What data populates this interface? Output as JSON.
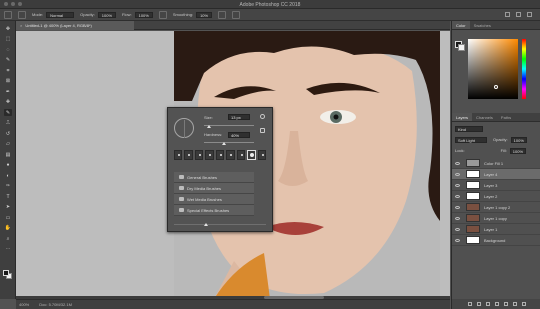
{
  "app": {
    "title": "Adobe Photoshop CC 2018"
  },
  "options_bar": {
    "mode_label": "Mode:",
    "mode_value": "Normal",
    "opacity_label": "Opacity:",
    "opacity_value": "100%",
    "flow_label": "Flow:",
    "flow_value": "100%",
    "smoothing_label": "Smoothing:",
    "smoothing_value": "10%"
  },
  "document": {
    "tab_label": "Untitled-1 @ 400% (Layer 4, RGB/8*)",
    "close_glyph": "×"
  },
  "status": {
    "zoom": "400%",
    "doc_size": "Doc: 5.70M/32.1M"
  },
  "brush_popup": {
    "size_label": "Size:",
    "size_value": "13 px",
    "hardness_label": "Hardness:",
    "hardness_value": "40%",
    "hardness_fraction": 0.4,
    "presets": [
      {
        "num": ""
      },
      {
        "num": ""
      },
      {
        "num": ""
      },
      {
        "num": ""
      },
      {
        "num": ""
      },
      {
        "num": ""
      },
      {
        "num": ""
      },
      {
        "num": ""
      },
      {
        "num": ""
      }
    ],
    "folders": [
      "General Brushes",
      "Dry Media Brushes",
      "Wet Media Brushes",
      "Special Effects Brushes"
    ]
  },
  "color_panel": {
    "tabs": [
      "Color",
      "Swatches"
    ]
  },
  "layers_panel": {
    "tabs": [
      "Layers",
      "Channels",
      "Paths"
    ],
    "kind_label": "Kind",
    "blend_mode": "Soft Light",
    "opacity_label": "Opacity:",
    "opacity_value": "100%",
    "lock_label": "Lock:",
    "fill_label": "Fill:",
    "fill_value": "100%",
    "layers": [
      {
        "name": "Color Fill 1",
        "thumb": "#9a9a9a",
        "selected": false
      },
      {
        "name": "Layer 4",
        "thumb": "#ffffff",
        "selected": true
      },
      {
        "name": "Layer 3",
        "thumb": "#ffffff",
        "selected": false
      },
      {
        "name": "Layer 2",
        "thumb": "#ffffff",
        "selected": false
      },
      {
        "name": "Layer 1 copy 2",
        "thumb": "#7a5040",
        "selected": false
      },
      {
        "name": "Layer 1 copy",
        "thumb": "#7a5040",
        "selected": false
      },
      {
        "name": "Layer 1",
        "thumb": "#7a5040",
        "selected": false
      },
      {
        "name": "Background",
        "thumb": "#ffffff",
        "selected": false
      }
    ]
  },
  "tools": [
    {
      "name": "move-tool-icon",
      "glyph": "✥"
    },
    {
      "name": "marquee-tool-icon",
      "glyph": "⬚"
    },
    {
      "name": "lasso-tool-icon",
      "glyph": "◌"
    },
    {
      "name": "quick-select-tool-icon",
      "glyph": "✎"
    },
    {
      "name": "crop-tool-icon",
      "glyph": "⌗"
    },
    {
      "name": "frame-tool-icon",
      "glyph": "⊠"
    },
    {
      "name": "eyedropper-tool-icon",
      "glyph": "✒"
    },
    {
      "name": "healing-brush-tool-icon",
      "glyph": "✚"
    },
    {
      "name": "brush-tool-icon",
      "glyph": "✎"
    },
    {
      "name": "clone-stamp-tool-icon",
      "glyph": "⎍"
    },
    {
      "name": "history-brush-tool-icon",
      "glyph": "↺"
    },
    {
      "name": "eraser-tool-icon",
      "glyph": "▱"
    },
    {
      "name": "gradient-tool-icon",
      "glyph": "▤"
    },
    {
      "name": "blur-tool-icon",
      "glyph": "●"
    },
    {
      "name": "dodge-tool-icon",
      "glyph": "◐"
    },
    {
      "name": "pen-tool-icon",
      "glyph": "✑"
    },
    {
      "name": "type-tool-icon",
      "glyph": "T"
    },
    {
      "name": "path-select-tool-icon",
      "glyph": "➤"
    },
    {
      "name": "rectangle-tool-icon",
      "glyph": "▭"
    },
    {
      "name": "hand-tool-icon",
      "glyph": "✋"
    },
    {
      "name": "zoom-tool-icon",
      "glyph": "⌕"
    },
    {
      "name": "more-tools-icon",
      "glyph": "⋯"
    }
  ]
}
